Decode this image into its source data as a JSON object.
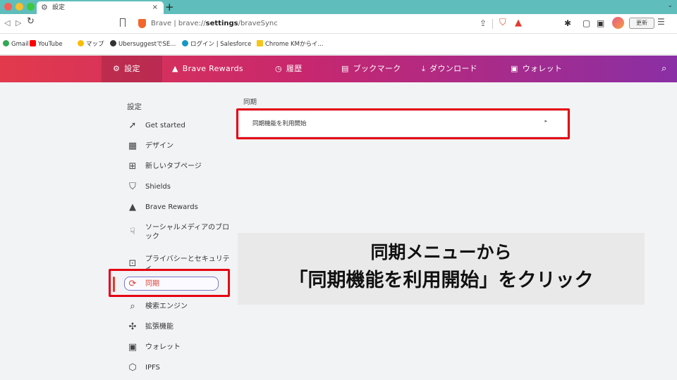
{
  "tab": {
    "title": "設定",
    "close": "×",
    "new": "+"
  },
  "toolbar": {
    "url_prefix": "Brave",
    "url_sep": " | brave://",
    "url_bold": "settings",
    "url_rest": "/braveSync",
    "update_label": "更新"
  },
  "bookmarks": [
    {
      "label": "Gmail",
      "color": "#34a853"
    },
    {
      "label": "YouTube",
      "color": "#ff0000"
    },
    {
      "label": "マップ",
      "color": "#fbbc04"
    },
    {
      "label": "UbersuggestでSE...",
      "color": "#333333"
    },
    {
      "label": "ログイン | Salesforce",
      "color": "#1798c1"
    },
    {
      "label": "Chrome KMからイ...",
      "color": "#f5c518"
    }
  ],
  "header": {
    "items": [
      {
        "label": "設定",
        "icon": "gear-icon"
      },
      {
        "label": "Brave Rewards",
        "icon": "rewards-triangle-icon"
      },
      {
        "label": "履歴",
        "icon": "history-icon"
      },
      {
        "label": "ブックマーク",
        "icon": "bookmark-icon"
      },
      {
        "label": "ダウンロード",
        "icon": "download-icon"
      },
      {
        "label": "ウォレット",
        "icon": "wallet-icon"
      }
    ]
  },
  "sidebar": {
    "title": "設定",
    "items": [
      {
        "label": "Get started",
        "icon": "rocket-icon"
      },
      {
        "label": "デザイン",
        "icon": "appearance-icon"
      },
      {
        "label": "新しいタブページ",
        "icon": "new-tab-icon"
      },
      {
        "label": "Shields",
        "icon": "shield-check-icon"
      },
      {
        "label": "Brave Rewards",
        "icon": "rewards-triangle-icon"
      },
      {
        "label": "ソーシャルメディアのブロック",
        "icon": "thumb-down-icon"
      },
      {
        "label": "プライバシーとセキュリティ",
        "icon": "lock-icon"
      },
      {
        "label": "同期",
        "icon": "sync-icon",
        "active": true
      },
      {
        "label": "検索エンジン",
        "icon": "search-icon"
      },
      {
        "label": "拡張機能",
        "icon": "puzzle-icon"
      },
      {
        "label": "ウォレット",
        "icon": "wallet-icon"
      },
      {
        "label": "IPFS",
        "icon": "ipfs-icon"
      }
    ]
  },
  "main": {
    "section_title": "同期",
    "sync_button_label": "同期機能を利用開始"
  },
  "annotation": {
    "line1": "同期メニューから",
    "line2": "「同期機能を利用開始」をクリック"
  },
  "colors": {
    "header_gradient_start": "#e23a4c",
    "header_gradient_end": "#8a2fa5",
    "highlight": "#e60012",
    "active_accent": "#e23b2e"
  }
}
